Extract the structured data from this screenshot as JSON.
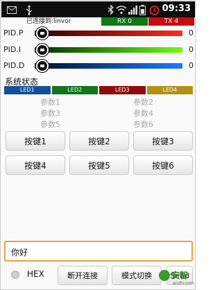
{
  "status_bar": {
    "time": "09:33",
    "icons": [
      "mail-icon",
      "usb-icon",
      "bluetooth-icon",
      "wifi-icon",
      "signal-icon",
      "battery-icon",
      "alarm-icon"
    ]
  },
  "connection": {
    "text": "已连接到:linvor",
    "rx": "RX 0",
    "tx": "TX 4",
    "colors": {
      "rx": "#0f7a11",
      "tx": "#c70c0c"
    }
  },
  "pid": [
    {
      "label": "PID.P",
      "value": "0",
      "color_from": "#2a0000",
      "color_to": "#ff2a1a"
    },
    {
      "label": "PID.I",
      "value": "0",
      "color_from": "#002a00",
      "color_to": "#6cff14"
    },
    {
      "label": "PID.D",
      "value": "0",
      "color_from": "#00102a",
      "color_to": "#1e7bff"
    }
  ],
  "system_status": {
    "title": "系统状态",
    "leds": [
      {
        "label": "LED1",
        "color": "#15509a"
      },
      {
        "label": "LED2",
        "color": "#11751a"
      },
      {
        "label": "LED3",
        "color": "#8c0d0d"
      },
      {
        "label": "LED4",
        "color": "#b19212"
      }
    ],
    "params": [
      "参数1",
      "参数2",
      "参数3",
      "参数4",
      "参数5",
      "参数6"
    ]
  },
  "buttons": [
    "按键1",
    "按键2",
    "按键3",
    "按键4",
    "按键5",
    "按键6"
  ],
  "input": {
    "value": "你好"
  },
  "bottom": {
    "hex_label": "HEX",
    "disconnect": "断开连接",
    "mode_switch": "模式切换",
    "send": "Send"
  },
  "watermark": {
    "text": "安智",
    "url": "anzhi.com"
  }
}
